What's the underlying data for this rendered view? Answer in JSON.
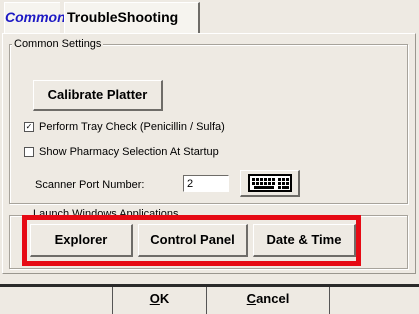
{
  "tabs": [
    {
      "label": "Common",
      "selected": true
    },
    {
      "label": "TroubleShooting",
      "selected": false
    }
  ],
  "common_settings": {
    "legend": "Common Settings",
    "calibrate_button": "Calibrate Platter",
    "tray_check": {
      "label": "Perform Tray Check (Penicillin / Sulfa)",
      "checked": true
    },
    "pharmacy_selection": {
      "label": "Show Pharmacy Selection At Startup",
      "checked": false
    },
    "scanner_port_label": "Scanner Port Number:",
    "scanner_port_value": "2"
  },
  "launch_apps": {
    "legend": "Launch Windows Applications",
    "buttons": [
      "Explorer",
      "Control Panel",
      "Date & Time"
    ]
  },
  "footer": {
    "ok_underline": "O",
    "ok_rest": "K",
    "cancel_underline": "C",
    "cancel_rest": "ancel"
  },
  "colors": {
    "tab_selected": "#1d19c4",
    "highlight": "#e60a14",
    "background": "#eeeae3"
  }
}
